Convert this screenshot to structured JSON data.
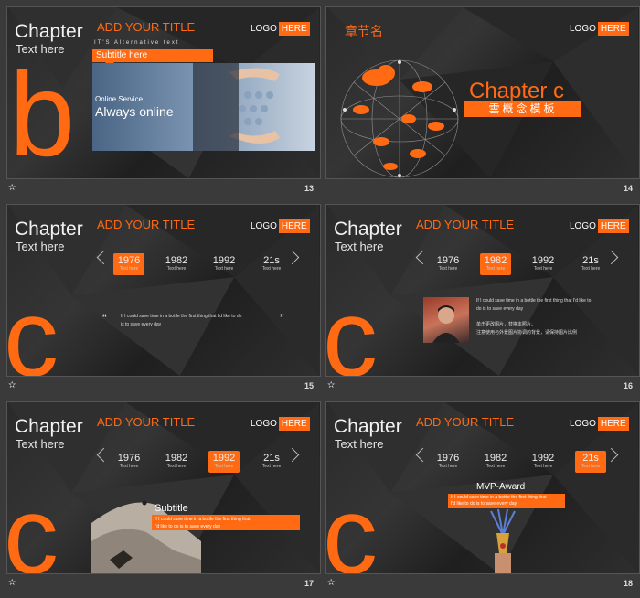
{
  "common": {
    "chapter": "Chapter",
    "text_here": "Text here",
    "add_title": "ADD YOUR TITLE",
    "logo": "LOGO",
    "here": "HERE",
    "star": "✫"
  },
  "slide13": {
    "number": "13",
    "letter": "b",
    "alt_text": "IT'S Alternative text",
    "subtitle": "Subtitle here",
    "online_service": "Online Service",
    "always_online": "Always online"
  },
  "slide14": {
    "number": "14",
    "section": "章节名",
    "chapter_c": "Chapter c",
    "cloud_concept": "雲概念模板"
  },
  "timeline": {
    "years": [
      "1976",
      "1982",
      "1992",
      "21s"
    ],
    "caption": "Text here"
  },
  "slide15": {
    "number": "15",
    "letter": "c",
    "quote_line1": "If I could save time in a bottle the first thing that I'd like to do",
    "quote_line2": "is to save every day",
    "quote_open": "“",
    "quote_close": "”"
  },
  "slide16": {
    "number": "16",
    "letter": "c",
    "line1": "If I could save time in a bottle the first thing that I'd like to",
    "line2": "do is to save every day",
    "line3": "单击更改图片，替换本照片。",
    "line4": "注意使用与外景图片协调的背景，请保持图片比例"
  },
  "slide17": {
    "number": "17",
    "letter": "c",
    "subtitle": "Subtitle",
    "line1": "If I could save time in a bottle the first thing that",
    "line2": "I'd like to do is to save every day"
  },
  "slide18": {
    "number": "18",
    "letter": "c",
    "award": "MVP-Award",
    "line1": "If I could save time in a bottle the first thing that",
    "line2": "I'd like to do is to save every day"
  }
}
